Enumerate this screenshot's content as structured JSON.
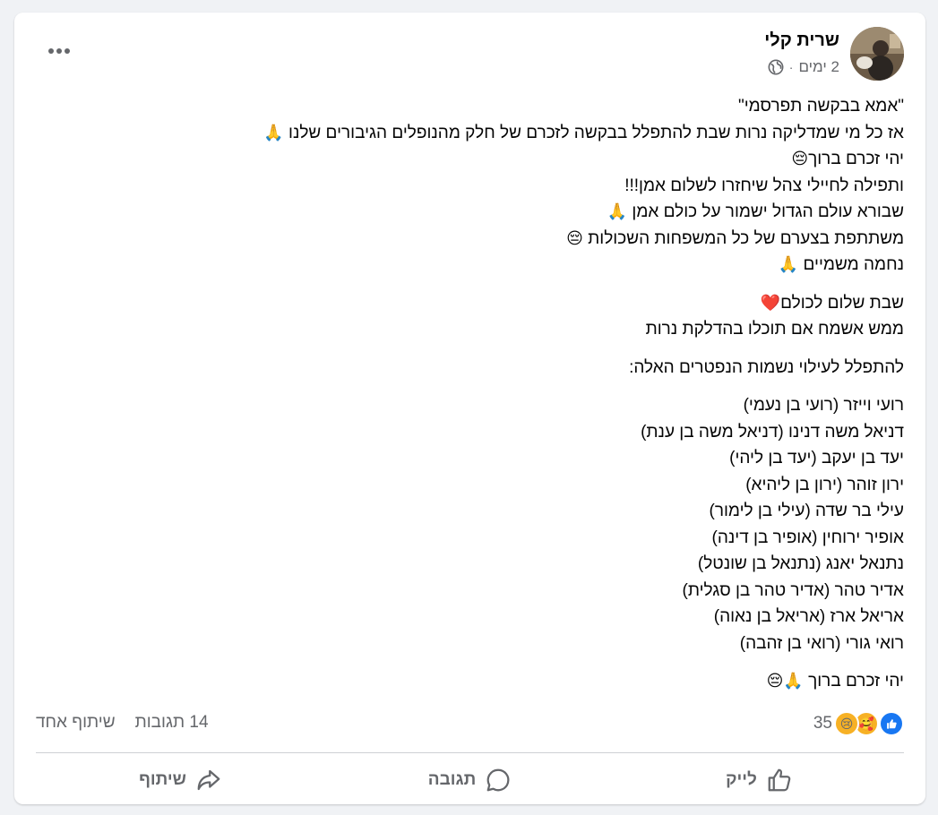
{
  "post": {
    "author": "שרית קלי",
    "time": "2 ימים",
    "separator": "·",
    "lines_intro": [
      {
        "text": "\"אמא בבקשה תפרסמי\"",
        "emoji": ""
      },
      {
        "text": "אז כל מי שמדליקה נרות שבת להתפלל בבקשה לזכרם של חלק מהנופלים הגיבורים שלנו ",
        "emoji": "🙏"
      },
      {
        "text": "יהי זכרם ברוך",
        "emoji": "😔"
      },
      {
        "text": "ותפילה לחיילי צהל שיחזרו לשלום אמן!!!",
        "emoji": ""
      },
      {
        "text": "שבורא עולם הגדול ישמור על כולם אמן ",
        "emoji": "🙏"
      },
      {
        "text": "משתתפת בצערם של כל המשפחות השכולות ",
        "emoji": "😔"
      },
      {
        "text": "נחמה משמיים ",
        "emoji": "🙏"
      }
    ],
    "lines_shabbat": [
      {
        "text": "שבת שלום לכולם",
        "emoji": "❤️"
      },
      {
        "text": "ממש אשמח אם תוכלו בהדלקת נרות",
        "emoji": ""
      }
    ],
    "prayer_heading": "להתפלל לעילוי נשמות הנפטרים האלה:",
    "names": [
      "רועי וייזר (רועי בן נעמי)",
      "דניאל משה דנינו (דניאל משה בן ענת)",
      "יעד בן יעקב (יעד בן ליהי)",
      "ירון זוהר (ירון בן ליהיא)",
      "עילי בר שדה (עילי בן לימור)",
      "אופיר ירוחין (אופיר בן דינה)",
      "נתנאל יאנג (נתנאל בן שונטל)",
      "אדיר טהר (אדיר טהר בן סגלית)",
      "אריאל ארז (אריאל בן נאוה)",
      "רואי גורי (רואי בן זהבה)"
    ],
    "closing": {
      "text": "יהי זכרם ברוך ",
      "emoji": "🙏😔"
    }
  },
  "stats": {
    "reaction_count": "35",
    "comments": "14 תגובות",
    "shares": "שיתוף אחד",
    "reaction_icons": [
      "like-icon",
      "care-icon",
      "sad-icon"
    ]
  },
  "actions": {
    "like": "לייק",
    "comment": "תגובה",
    "share": "שיתוף"
  },
  "colors": {
    "like_blue": "#1877f2",
    "secondary_text": "#65676b",
    "background": "#f0f2f5"
  }
}
